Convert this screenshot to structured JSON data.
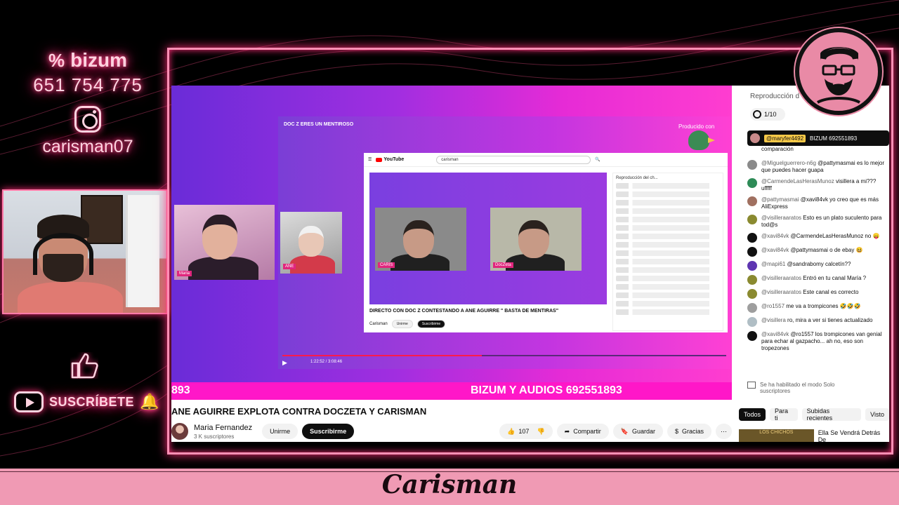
{
  "overlay": {
    "bizum_label": "bizum",
    "bizum_phone": "651 754 775",
    "instagram_handle": "carisman07",
    "subscribe_label": "SUSCRÍBETE",
    "brand": "Carisman"
  },
  "inner_stream": {
    "title": "DOC Z ERES UN MENTIROSO",
    "produced_by": "Producido con",
    "cam_maria": "Maria",
    "cam_ane": "ANE",
    "yt_logo": "YouTube",
    "yt_search": "carisman",
    "yt_video_title": "DIRECTO CON DOC Z CONTESTANDO A ANE AGUIRRE \" BASTA DE MENTIRAS\"",
    "yt_channel": "Carisman",
    "yt_join": "Unirme",
    "yt_subscribe": "Suscribirme",
    "yt_chat_header": "Reproducción del ch...",
    "tile1_tag": "CARIS",
    "tile2_tag": "DocZeta",
    "time": "1:22:52 / 3:08:46",
    "progress": 0.45
  },
  "player": {
    "bar_left": "893",
    "bar_right": "BIZUM Y AUDIOS 692551893"
  },
  "video": {
    "title": "ANE AGUIRRE EXPLOTA CONTRA DOCZETA Y CARISMAN",
    "channel_name": "Maria Fernandez",
    "channel_subs": "3 K suscriptores",
    "join": "Unirme",
    "subscribe": "Suscribirme",
    "likes": "107",
    "share": "Compartir",
    "save": "Guardar",
    "thanks": "Gracias"
  },
  "chat": {
    "title": "Reproducción d",
    "count": "1/10",
    "pinned_user": "@maryfer4492",
    "pinned_text": "BIZUM 692551893",
    "messages": [
      {
        "author": "",
        "text": "comparación",
        "color": "#ffffff"
      },
      {
        "author": "@Miguelguerrero-n6g",
        "text": "@pattymasmai es lo mejor que puedes hacer guapa",
        "color": "#8a8a8a"
      },
      {
        "author": "@CarmendeLasHerasMunoz",
        "text": "visillera a mi??? ufffff",
        "color": "#2e8b57"
      },
      {
        "author": "@pattymasmai",
        "text": "@xavi84vk yo creo que es más AliExpress",
        "color": "#a07060"
      },
      {
        "author": "@visilleraaratos",
        "text": "Esto es un plato suculento para tod@s",
        "color": "#8a8a30"
      },
      {
        "author": "@xavi84vk",
        "text": "@CarmendeLasHerasMunoz no 😛",
        "color": "#111111"
      },
      {
        "author": "@xavi84vk",
        "text": "@pattymasmai o de ebay 😆",
        "color": "#111111"
      },
      {
        "author": "@mapi61",
        "text": "@sandrabomy calcetín??",
        "color": "#5e35b1"
      },
      {
        "author": "@visilleraaratos",
        "text": "Entró en tu canal María ?",
        "color": "#8a8a30"
      },
      {
        "author": "@visilleraaratos",
        "text": "Este canal es correcto",
        "color": "#8a8a30"
      },
      {
        "author": "@ro1557",
        "text": "me va a trompicones 🤣🤣🤣",
        "color": "#9e9e9e"
      },
      {
        "author": "@visillera",
        "text": "ro, mira a ver si tienes actualizado",
        "color": "#b0bec5"
      },
      {
        "author": "@xavi84vk",
        "text": "@ro1557 los trompicones van genial para echar al gazpacho... ah no, eso son tropezones",
        "color": "#111111"
      }
    ],
    "solo_mode": "Se ha habilitado el modo Solo suscriptores"
  },
  "chips": [
    "Todos",
    "Para ti",
    "Subidas recientes",
    "Visto"
  ],
  "recommendation": {
    "thumb": "LOS CHICHOS",
    "title": "Ella Se Vendrá Detrás De"
  }
}
